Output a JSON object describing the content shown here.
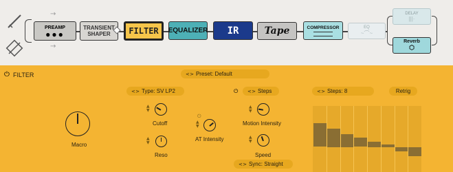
{
  "chain": {
    "modules": {
      "preamp": "PREAMP",
      "preamp_dots": "●●●",
      "transient_line1": "TRANSIENT",
      "transient_line2": "SHAPER",
      "filter": "FILTER",
      "equalizer": "EQUALIZER",
      "ir": "IR",
      "tape": "Tape",
      "compressor": "COMPRESSOR",
      "eq": "EQ",
      "eq_wave": "~⌒~",
      "delay": "DELAY",
      "delay_wave": "|||·",
      "reverb": "Reverb",
      "reverb_icon": "⬡"
    },
    "arrow": "→"
  },
  "panel": {
    "title": "FILTER",
    "power_icon": "⏻",
    "preset_label": "Preset: Default",
    "type_label": "Type: SV LP2",
    "steps_mode": "Steps",
    "steps_count": "Steps: 8",
    "retrig": "Retrig",
    "sync": "Sync: Straight",
    "knobs": {
      "macro": "Macro",
      "cutoff": "Cutoff",
      "reso": "Reso",
      "at_intensity": "AT Intensity",
      "motion_intensity": "Motion Intensity",
      "speed": "Speed"
    },
    "step_values": [
      0.9,
      0.7,
      0.5,
      0.35,
      0.2,
      0.1,
      -0.15,
      -0.35
    ]
  }
}
